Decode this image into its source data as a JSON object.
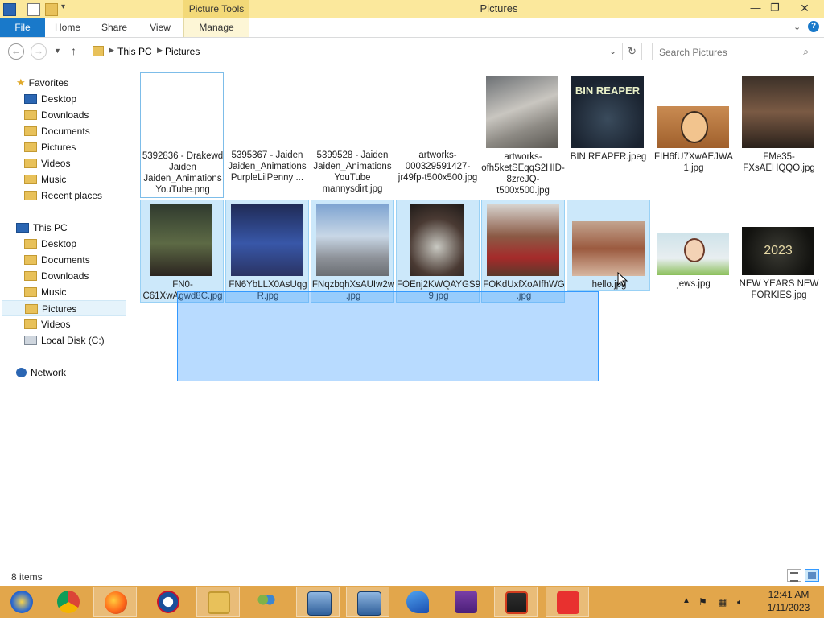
{
  "window": {
    "title": "Pictures",
    "contextual_tab_group": "Picture Tools",
    "minimize": "—",
    "maximize": "❐",
    "close": "✕"
  },
  "ribbon": {
    "tabs": [
      "File",
      "Home",
      "Share",
      "View",
      "Manage"
    ]
  },
  "address": {
    "crumbs": [
      "This PC",
      "Pictures"
    ],
    "search_placeholder": "Search Pictures"
  },
  "nav": {
    "favorites_header": "Favorites",
    "favorites": [
      "Desktop",
      "Downloads",
      "Documents",
      "Pictures",
      "Videos",
      "Music",
      "Recent places"
    ],
    "thispc_header": "This PC",
    "thispc": [
      "Desktop",
      "Documents",
      "Downloads",
      "Music",
      "Pictures",
      "Videos",
      "Local Disk (C:)"
    ],
    "network": "Network"
  },
  "files": [
    {
      "name": "5392836 - Drakewd Jaiden Jaiden_Animations YouTube.png"
    },
    {
      "name": "5395367 - Jaiden Jaiden_Animations PurpleLilPenny ..."
    },
    {
      "name": "5399528 - Jaiden Jaiden_Animations YouTube mannysdirt.jpg"
    },
    {
      "name": "artworks-000329591427-jr49fp-t500x500.jpg"
    },
    {
      "name": "artworks-ofh5ketSEqqS2HID-8zreJQ-t500x500.jpg"
    },
    {
      "name": "BIN REAPER.jpeg",
      "art_text": "BIN REAPER"
    },
    {
      "name": "FIH6fU7XwAEJWA1.jpg"
    },
    {
      "name": "FMe35-FXsAEHQQO.jpg"
    },
    {
      "name": "FN0-C61XwAgwd8C.jpg"
    },
    {
      "name": "FN6YbLLX0AsUqgR.jpg"
    },
    {
      "name": "FNqzbqhXsAUIw2w.jpg"
    },
    {
      "name": "FOEnj2KWQAYGS99.jpg"
    },
    {
      "name": "FOKdUxfXoAIfhWG.jpg"
    },
    {
      "name": "hello.jpg"
    },
    {
      "name": "jews.jpg"
    },
    {
      "name": "NEW YEARS NEW FORKIES.jpg",
      "art_text": "2023"
    }
  ],
  "status": {
    "items": "8 items"
  },
  "clock": {
    "time": "12:41 AM",
    "date": "1/11/2023"
  },
  "colors": {
    "titlebar": "#fbe89c",
    "file_tab": "#1979ca",
    "taskbar": "#e2a64b",
    "marquee": "#3399ff",
    "selection": "#cce8fa"
  }
}
